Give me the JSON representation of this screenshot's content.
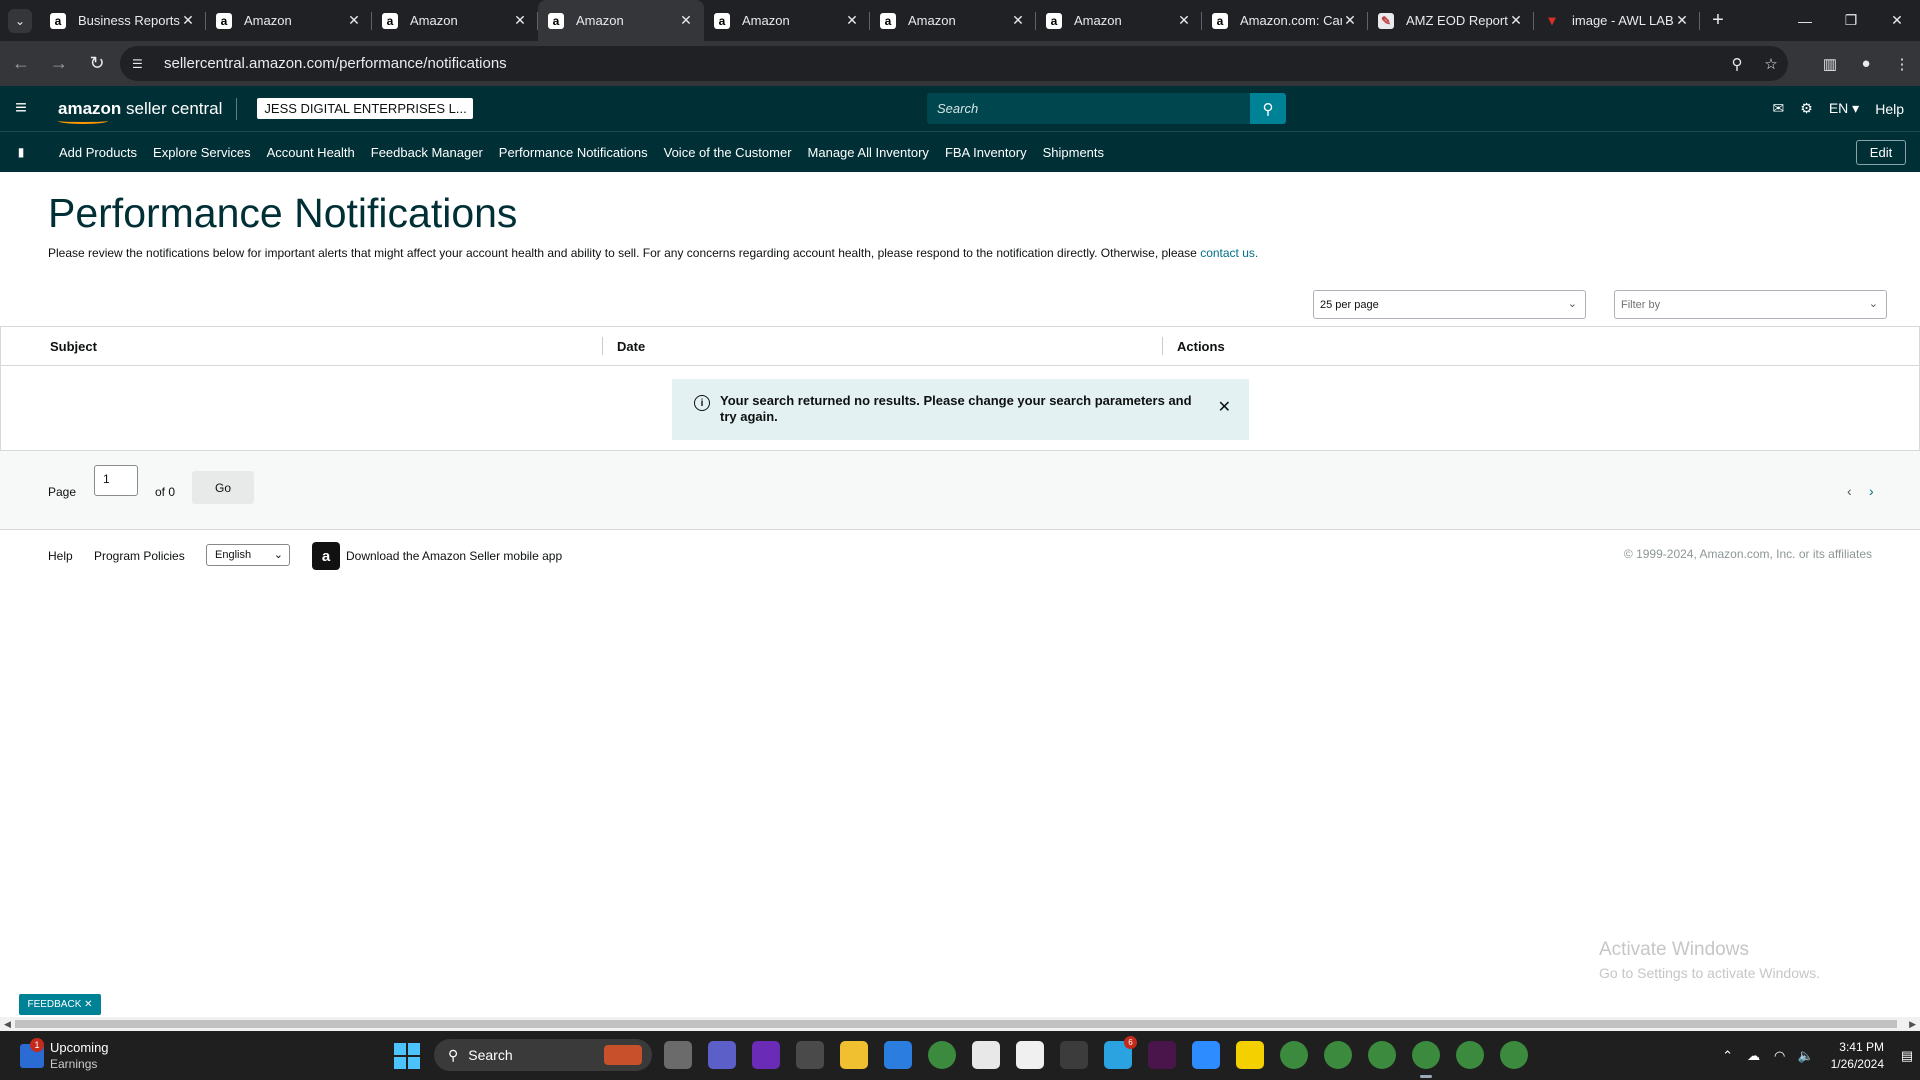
{
  "browser": {
    "tabs": [
      {
        "title": "Business Reports",
        "favicon": "a"
      },
      {
        "title": "Amazon",
        "favicon": "a"
      },
      {
        "title": "Amazon",
        "favicon": "a"
      },
      {
        "title": "Amazon",
        "favicon": "a",
        "active": true
      },
      {
        "title": "Amazon",
        "favicon": "a"
      },
      {
        "title": "Amazon",
        "favicon": "a"
      },
      {
        "title": "Amazon",
        "favicon": "a"
      },
      {
        "title": "Amazon.com: Car",
        "favicon": "a"
      },
      {
        "title": "AMZ EOD Report",
        "favicon": "eod"
      },
      {
        "title": "image - AWL LAB",
        "favicon": "awl"
      }
    ],
    "url": "sellercentral.amazon.com/performance/notifications"
  },
  "header": {
    "logo_bold": "amazon",
    "logo_rest": " seller central",
    "merchant": "JESS DIGITAL ENTERPRISES L...",
    "search_placeholder": "Search",
    "lang": "EN ▾",
    "help": "Help"
  },
  "nav": {
    "links": [
      "Add Products",
      "Explore Services",
      "Account Health",
      "Feedback Manager",
      "Performance Notifications",
      "Voice of the Customer",
      "Manage All Inventory",
      "FBA Inventory",
      "Shipments"
    ],
    "edit": "Edit"
  },
  "page": {
    "title": "Performance Notifications",
    "description": "Please review the notifications below for important alerts that might affect your account health and ability to sell. For any concerns regarding account health, please respond to the notification directly. Otherwise, please ",
    "contact_link": "contact us.",
    "per_page": "25 per page",
    "filter_placeholder": "Filter by"
  },
  "table": {
    "columns": [
      "Subject",
      "Date",
      "Actions"
    ],
    "alert": "Your search returned no results. Please change your search parameters and try again."
  },
  "pager": {
    "page_label": "Page",
    "page_value": "1",
    "of_label": "of 0",
    "go": "Go"
  },
  "footer": {
    "help": "Help",
    "policies": "Program Policies",
    "language": "English",
    "app_text": "Download the Amazon Seller mobile app",
    "copyright": "© 1999-2024, Amazon.com, Inc. or its affiliates"
  },
  "watermark": {
    "line1": "Activate Windows",
    "line2": "Go to Settings to activate Windows."
  },
  "feedback": "FEEDBACK ✕",
  "taskbar": {
    "weather_title": "Upcoming",
    "weather_sub": "Earnings",
    "weather_badge": "1",
    "search": "Search",
    "time": "3:41 PM",
    "date": "1/26/2024",
    "icons": [
      {
        "name": "task-view-icon",
        "color": "#6b6b6b"
      },
      {
        "name": "video-icon",
        "color": "#5b5fc7"
      },
      {
        "name": "nzxt-icon",
        "color": "#6a2bb6"
      },
      {
        "name": "refresh-app-icon",
        "color": "#4a4a4a"
      },
      {
        "name": "file-explorer-icon",
        "color": "#f0c030"
      },
      {
        "name": "calendar-icon",
        "color": "#2b7de0"
      },
      {
        "name": "chrome-icon",
        "color": "#3b8a3e"
      },
      {
        "name": "chart-app-icon",
        "color": "#e8e8e8"
      },
      {
        "name": "chart-app-2-icon",
        "color": "#f0f0f0"
      },
      {
        "name": "calculator-icon",
        "color": "#3c3c3c"
      },
      {
        "name": "telegram-icon",
        "color": "#2aa3e0",
        "badge": "6"
      },
      {
        "name": "slack-icon",
        "color": "#4a154b"
      },
      {
        "name": "zoom-icon",
        "color": "#2d8cff"
      },
      {
        "name": "sticky-notes-icon",
        "color": "#f5d000"
      },
      {
        "name": "chrome-profile-1-icon",
        "color": "#3b8a3e"
      },
      {
        "name": "chrome-profile-2-icon",
        "color": "#3b8a3e"
      },
      {
        "name": "chrome-profile-3-icon",
        "color": "#3b8a3e"
      },
      {
        "name": "chrome-profile-4-icon",
        "color": "#3b8a3e",
        "active": true
      },
      {
        "name": "chrome-profile-5-icon",
        "color": "#3b8a3e"
      },
      {
        "name": "chrome-profile-6-icon",
        "color": "#3b8a3e"
      }
    ]
  },
  "colors": {
    "header_bg": "#002f36",
    "link": "#007185",
    "accent": "#008296",
    "alert_bg": "#e3f1f3"
  }
}
